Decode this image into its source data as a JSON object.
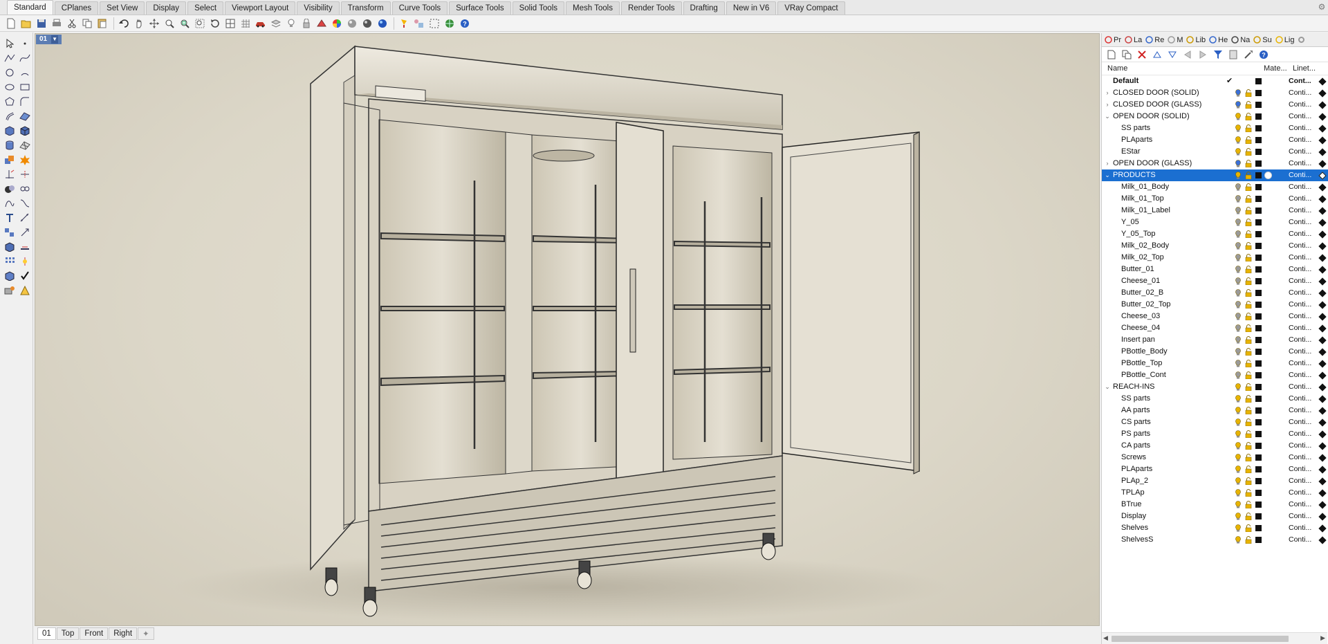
{
  "ribbon_tabs": [
    "Standard",
    "CPlanes",
    "Set View",
    "Display",
    "Select",
    "Viewport Layout",
    "Visibility",
    "Transform",
    "Curve Tools",
    "Surface Tools",
    "Solid Tools",
    "Mesh Tools",
    "Render Tools",
    "Drafting",
    "New in V6",
    "VRay Compact"
  ],
  "active_ribbon_tab": "Standard",
  "toolbar_icons": [
    "new-file-icon",
    "open-file-icon",
    "save-icon",
    "print-icon",
    "cut-icon",
    "copy-icon",
    "paste-icon",
    "undo-icon",
    "pan-icon",
    "move-view-icon",
    "zoom-icon",
    "zoom-window-icon",
    "zoom-extents-icon",
    "rotate-view-icon",
    "four-viewports-icon",
    "grid-icon",
    "car-icon",
    "layer-icon",
    "bulb-icon",
    "lock-icon",
    "material-icon",
    "color-wheel-icon",
    "shaded-sphere-icon",
    "rendered-sphere-icon",
    "render-icon",
    "help-icon"
  ],
  "viewport": {
    "title": "01"
  },
  "viewport_tabs": [
    "01",
    "Top",
    "Front",
    "Right"
  ],
  "viewport_tab_add": "✦",
  "panel": {
    "tabs": [
      {
        "label": "Pr",
        "icon": "properties-icon"
      },
      {
        "label": "La",
        "icon": "layers-icon"
      },
      {
        "label": "Re",
        "icon": "render-icon"
      },
      {
        "label": "M",
        "icon": "materials-icon"
      },
      {
        "label": "Lib",
        "icon": "libraries-icon"
      },
      {
        "label": "He",
        "icon": "help-icon"
      },
      {
        "label": "Na",
        "icon": "named-views-icon"
      },
      {
        "label": "Su",
        "icon": "sun-icon"
      },
      {
        "label": "Lig",
        "icon": "lights-icon"
      }
    ],
    "columns": {
      "name": "Name",
      "material": "Mate...",
      "linetype": "Linet..."
    },
    "layers": [
      {
        "name": "Default",
        "level": 0,
        "expander": "",
        "bold": true,
        "current": true,
        "linetype": "Cont...",
        "selected": false
      },
      {
        "name": "CLOSED DOOR (SOLID)",
        "level": 0,
        "expander": "›",
        "linetype": "Conti...",
        "bulb_color": "#3a6fd8"
      },
      {
        "name": "CLOSED DOOR (GLASS)",
        "level": 0,
        "expander": "›",
        "linetype": "Conti...",
        "bulb_color": "#3a6fd8"
      },
      {
        "name": "OPEN DOOR (SOLID)",
        "level": 0,
        "expander": "⌄",
        "linetype": "Conti..."
      },
      {
        "name": "SS parts",
        "level": 1,
        "linetype": "Conti..."
      },
      {
        "name": "PLAparts",
        "level": 1,
        "linetype": "Conti..."
      },
      {
        "name": "EStar",
        "level": 1,
        "linetype": "Conti..."
      },
      {
        "name": "OPEN DOOR (GLASS)",
        "level": 0,
        "expander": "›",
        "linetype": "Conti...",
        "bulb_color": "#3a6fd8"
      },
      {
        "name": "PRODUCTS",
        "level": 0,
        "expander": "⌄",
        "linetype": "Conti...",
        "selected": true
      },
      {
        "name": "Milk_01_Body",
        "level": 1,
        "linetype": "Conti...",
        "bulb_color": "#9a9a9a"
      },
      {
        "name": "Milk_01_Top",
        "level": 1,
        "linetype": "Conti...",
        "bulb_color": "#9a9a9a"
      },
      {
        "name": "Milk_01_Label",
        "level": 1,
        "linetype": "Conti...",
        "bulb_color": "#9a9a9a"
      },
      {
        "name": "Y_05",
        "level": 1,
        "linetype": "Conti...",
        "bulb_color": "#9a9a9a"
      },
      {
        "name": "Y_05_Top",
        "level": 1,
        "linetype": "Conti...",
        "bulb_color": "#9a9a9a"
      },
      {
        "name": "Milk_02_Body",
        "level": 1,
        "linetype": "Conti...",
        "bulb_color": "#9a9a9a"
      },
      {
        "name": "Milk_02_Top",
        "level": 1,
        "linetype": "Conti...",
        "bulb_color": "#9a9a9a"
      },
      {
        "name": "Butter_01",
        "level": 1,
        "linetype": "Conti...",
        "bulb_color": "#9a9a9a"
      },
      {
        "name": "Cheese_01",
        "level": 1,
        "linetype": "Conti...",
        "bulb_color": "#9a9a9a"
      },
      {
        "name": "Butter_02_B",
        "level": 1,
        "linetype": "Conti...",
        "bulb_color": "#9a9a9a"
      },
      {
        "name": "Butter_02_Top",
        "level": 1,
        "linetype": "Conti...",
        "bulb_color": "#9a9a9a"
      },
      {
        "name": "Cheese_03",
        "level": 1,
        "linetype": "Conti...",
        "bulb_color": "#9a9a9a"
      },
      {
        "name": "Cheese_04",
        "level": 1,
        "linetype": "Conti...",
        "bulb_color": "#9a9a9a"
      },
      {
        "name": "Insert pan",
        "level": 1,
        "linetype": "Conti...",
        "bulb_color": "#9a9a9a"
      },
      {
        "name": "PBottle_Body",
        "level": 1,
        "linetype": "Conti...",
        "bulb_color": "#9a9a9a"
      },
      {
        "name": "PBottle_Top",
        "level": 1,
        "linetype": "Conti...",
        "bulb_color": "#9a9a9a"
      },
      {
        "name": "PBottle_Cont",
        "level": 1,
        "linetype": "Conti...",
        "bulb_color": "#9a9a9a"
      },
      {
        "name": "REACH-INS",
        "level": 0,
        "expander": "⌄",
        "linetype": "Conti..."
      },
      {
        "name": "SS parts",
        "level": 1,
        "linetype": "Conti..."
      },
      {
        "name": "AA parts",
        "level": 1,
        "linetype": "Conti..."
      },
      {
        "name": "CS parts",
        "level": 1,
        "linetype": "Conti..."
      },
      {
        "name": "PS parts",
        "level": 1,
        "linetype": "Conti..."
      },
      {
        "name": "CA parts",
        "level": 1,
        "linetype": "Conti..."
      },
      {
        "name": "Screws",
        "level": 1,
        "linetype": "Conti..."
      },
      {
        "name": "PLAparts",
        "level": 1,
        "linetype": "Conti..."
      },
      {
        "name": "PLAp_2",
        "level": 1,
        "linetype": "Conti..."
      },
      {
        "name": "TPLAp",
        "level": 1,
        "linetype": "Conti..."
      },
      {
        "name": "BTrue",
        "level": 1,
        "linetype": "Conti..."
      },
      {
        "name": "Display",
        "level": 1,
        "linetype": "Conti..."
      },
      {
        "name": "Shelves",
        "level": 1,
        "linetype": "Conti..."
      },
      {
        "name": "ShelvesS",
        "level": 1,
        "linetype": "Conti..."
      }
    ]
  },
  "colors": {
    "selection": "#1b6fd1",
    "viewport_title": "#5c7db3",
    "bulb_on": "#e8b400",
    "lock": "#d8a000"
  }
}
